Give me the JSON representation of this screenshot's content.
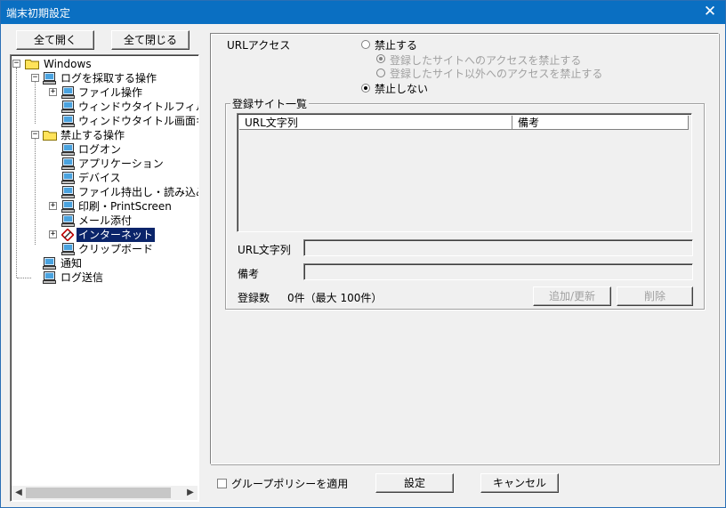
{
  "window": {
    "title": "端末初期設定",
    "close_glyph": "✕"
  },
  "tree_buttons": {
    "expand_all": "全て開く",
    "collapse_all": "全て閉じる"
  },
  "tree": {
    "root": "Windows",
    "log_ops": "ログを採取する操作",
    "file_ops": "ファイル操作",
    "window_title_filter": "ウィンドウタイトルフィルタ",
    "window_title_capture": "ウィンドウタイトル画面キャ",
    "prohibited_ops": "禁止する操作",
    "logon": "ログオン",
    "application": "アプリケーション",
    "device": "デバイス",
    "file_transfer": "ファイル持出し・読み込み",
    "print": "印刷・PrintScreen",
    "mail_attach": "メール添付",
    "internet": "インターネット",
    "clipboard": "クリップボード",
    "notify": "通知",
    "log_send": "ログ送信"
  },
  "url_access": {
    "label": "URLアクセス",
    "opt_prohibit": "禁止する",
    "sub_opt_registered": "登録したサイトへのアクセスを禁止する",
    "sub_opt_except": "登録したサイト以外へのアクセスを禁止する",
    "opt_allow": "禁止しない"
  },
  "site_list": {
    "group_title": "登録サイト一覧",
    "col_url": "URL文字列",
    "col_note": "備考",
    "field_url_label": "URL文字列",
    "field_note_label": "備考",
    "field_url_value": "",
    "field_note_value": "",
    "count_label": "登録数",
    "count_value": "0件（最大 100件）",
    "add_button": "追加/更新",
    "delete_button": "削除"
  },
  "footer": {
    "group_policy_label": "グループポリシーを適用",
    "ok_button": "設定",
    "cancel_button": "キャンセル"
  },
  "scroll": {
    "left_arrow": "◀",
    "right_arrow": "▶"
  },
  "tree_expanders": {
    "minus": "−",
    "plus": "+"
  }
}
